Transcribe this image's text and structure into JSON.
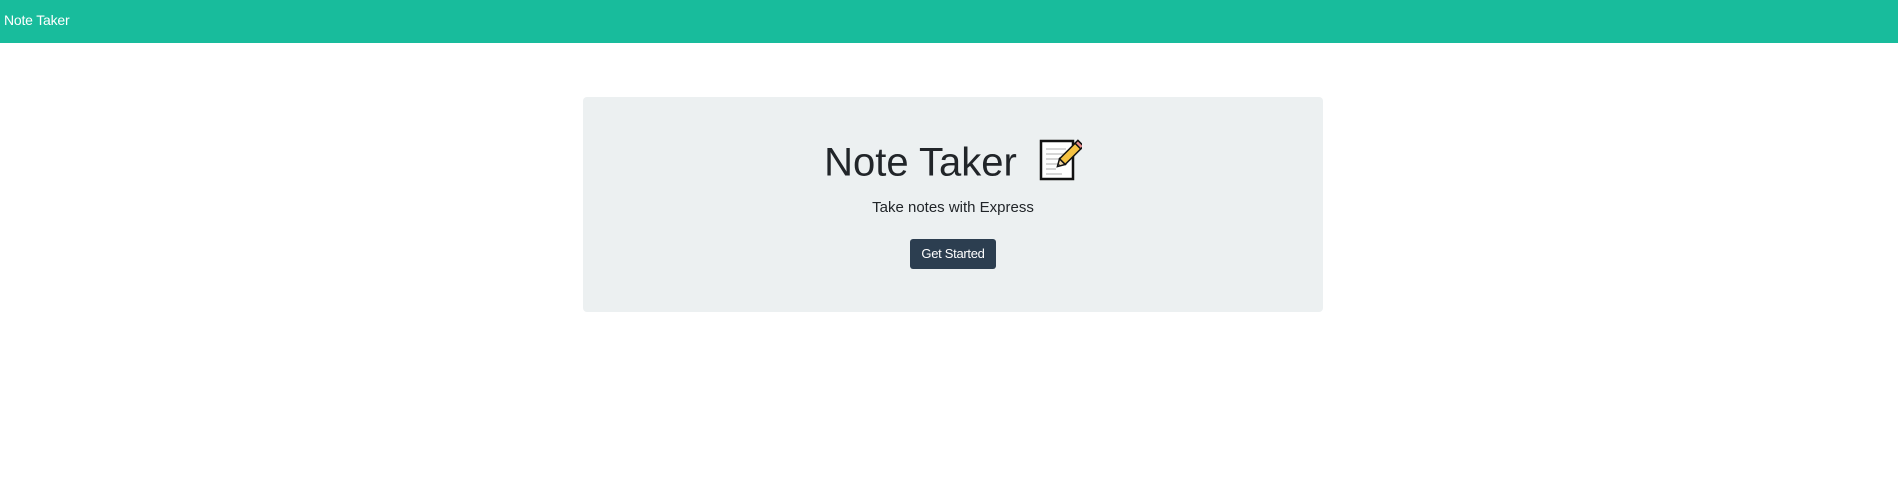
{
  "navbar": {
    "brand": "Note Taker",
    "background": "#18bc9c"
  },
  "jumbotron": {
    "title": "Note Taker",
    "title_icon": "memo-icon",
    "subtitle": "Take notes with Express",
    "button_label": "Get Started",
    "background": "#ecf0f1",
    "button_color": "#2c3e50"
  }
}
